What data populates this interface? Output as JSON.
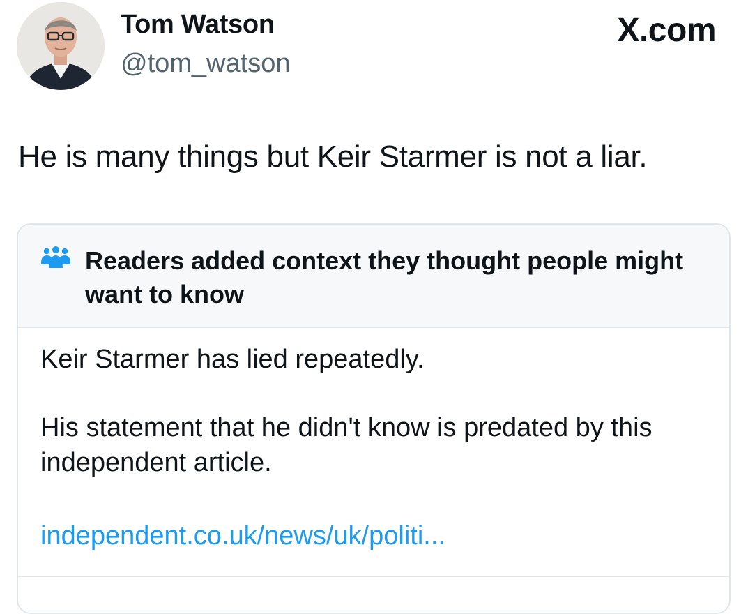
{
  "author": {
    "name": "Tom Watson",
    "handle": "@tom_watson",
    "avatar_icon": "profile-photo"
  },
  "site": {
    "mark": "X.com"
  },
  "tweet": {
    "text": "He is many things but Keir Starmer is not a liar."
  },
  "community_note": {
    "icon": "people-icon",
    "accent_color": "#1d9bf0",
    "title": "Readers added context they thought people might want to know",
    "paragraph_1": "Keir Starmer has lied repeatedly.",
    "paragraph_2": "His statement that he didn't know is predated by this independent article.",
    "link": "independent.co.uk/news/uk/politi..."
  }
}
